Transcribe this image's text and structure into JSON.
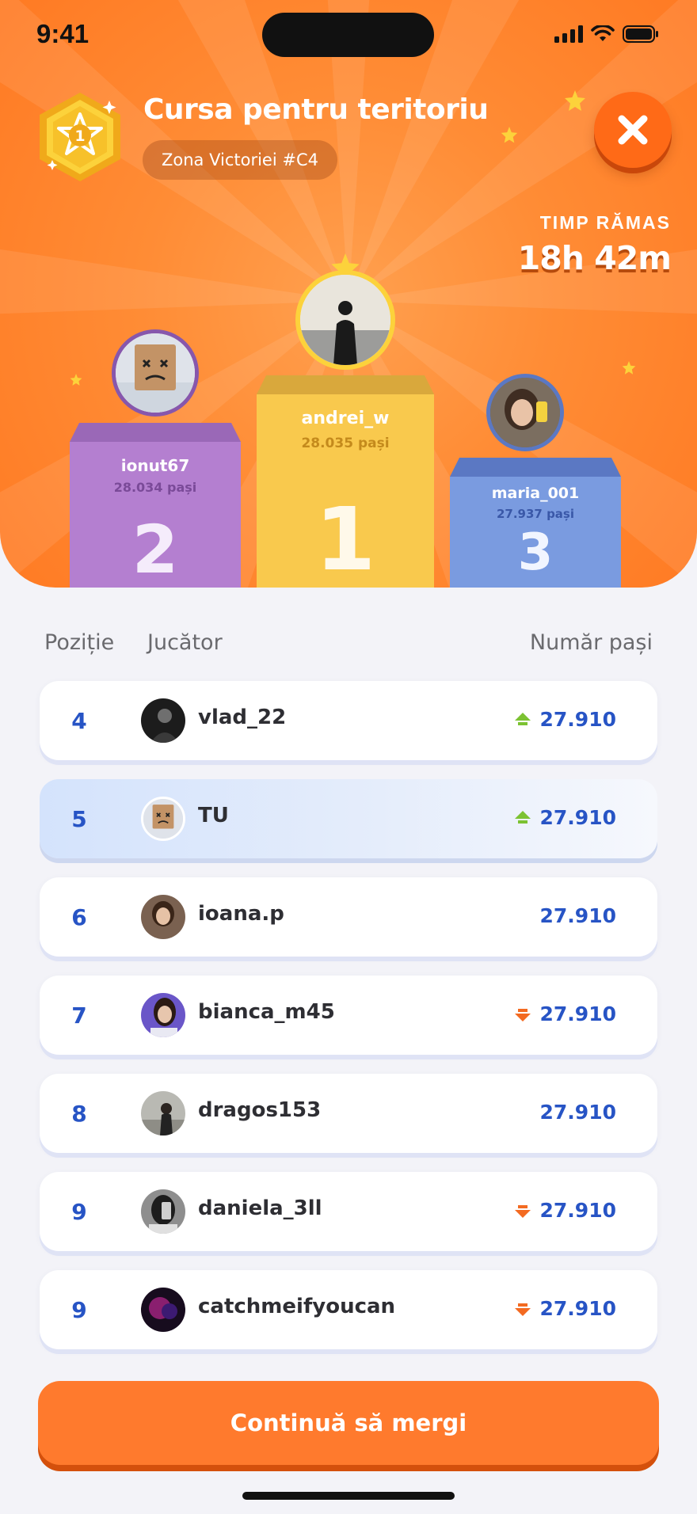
{
  "status_bar": {
    "time": "9:41"
  },
  "header": {
    "badge_rank": "1",
    "title": "Cursa pentru teritoriu",
    "zone": "Zona Victoriei #C4",
    "timer_label": "TIMP RĂMAS",
    "timer_value": "18h 42m"
  },
  "podium": [
    {
      "rank": "1",
      "name": "andrei_w",
      "steps": "28.035 pași",
      "color": "#f9c94d",
      "avatar": "sunset-silhouette"
    },
    {
      "rank": "2",
      "name": "ionut67",
      "steps": "28.034 pași",
      "color": "#b47fd0",
      "avatar": "box-head-mascot"
    },
    {
      "rank": "3",
      "name": "maria_001",
      "steps": "27.937 pași",
      "color": "#7a9be0",
      "avatar": "girl-selfie"
    }
  ],
  "table": {
    "columns": {
      "position": "Poziție",
      "player": "Jucător",
      "steps": "Număr pași"
    },
    "rows": [
      {
        "position": "4",
        "name": "vlad_22",
        "steps": "27.910",
        "trend": "up"
      },
      {
        "position": "5",
        "name": "TU",
        "steps": "27.910",
        "trend": "up",
        "highlighted": true
      },
      {
        "position": "6",
        "name": "ioana.p",
        "steps": "27.910",
        "trend": "none"
      },
      {
        "position": "7",
        "name": "bianca_m45",
        "steps": "27.910",
        "trend": "down"
      },
      {
        "position": "8",
        "name": "dragos153",
        "steps": "27.910",
        "trend": "none"
      },
      {
        "position": "9",
        "name": "daniela_3ll",
        "steps": "27.910",
        "trend": "down"
      },
      {
        "position": "9",
        "name": "catchmeifyoucan",
        "steps": "27.910",
        "trend": "down"
      }
    ]
  },
  "cta": {
    "label": "Continuă să mergi"
  },
  "colors": {
    "accent_orange": "#ff7a2d",
    "steps_blue": "#2754c5",
    "trend_up": "#7cc232",
    "trend_down": "#f36a21"
  }
}
